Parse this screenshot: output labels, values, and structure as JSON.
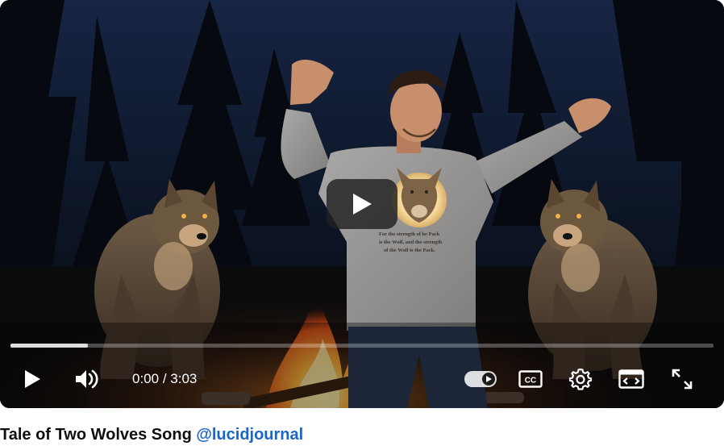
{
  "player": {
    "current_time": "0:00",
    "duration": "3:03",
    "time_separator": " / ",
    "progress_fraction": 0.11,
    "autoplay_on": true,
    "cc_label": "CC",
    "shirt_text": [
      "For the strength of he Pack",
      "is the Wolf, and the strength",
      "of the Wolf is the Pack."
    ]
  },
  "caption": {
    "title": "Tale of Two Wolves Song",
    "handle": "@lucidjournal"
  },
  "icons": {
    "play": "play-icon",
    "volume": "volume-icon",
    "autoplay": "autoplay-toggle-icon",
    "cc": "closed-captions-icon",
    "settings": "gear-icon",
    "theater": "theater-mode-icon",
    "fullscreen": "fullscreen-icon"
  },
  "colors": {
    "progress_fill": "#ffffff",
    "handle": "#1a66c6",
    "night_sky": "#0c1322",
    "fire": "#f28b1c"
  }
}
